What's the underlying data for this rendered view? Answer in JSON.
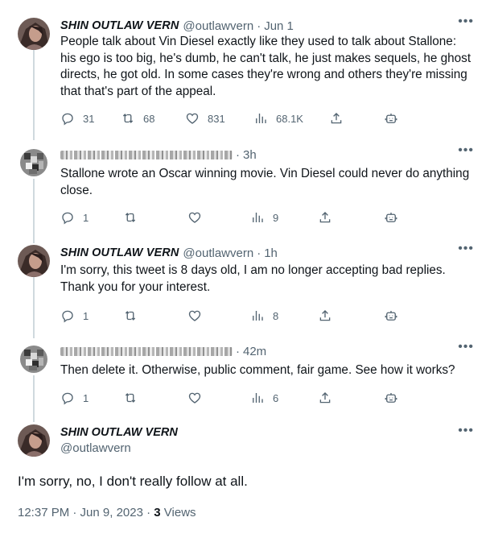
{
  "replies": [
    {
      "author_name": "SHIN OUTLAW VERN",
      "handle": "@outlawvern",
      "time": "Jun 1",
      "text": "People talk about Vin Diesel exactly like they used to talk about Stallone: his ego is too big, he's dumb, he can't talk, he just makes sequels, he ghost directs, he got old. In some cases they're wrong and others they're missing that that's part of the appeal.",
      "replies_count": "31",
      "retweets_count": "68",
      "likes_count": "831",
      "views_count": "68.1K"
    },
    {
      "author_name": "",
      "handle": "",
      "time": "3h",
      "text": "Stallone wrote an Oscar winning movie. Vin Diesel could never do anything close.",
      "replies_count": "1",
      "retweets_count": "",
      "likes_count": "",
      "views_count": "9"
    },
    {
      "author_name": "SHIN OUTLAW VERN",
      "handle": "@outlawvern",
      "time": "1h",
      "text": "I'm sorry, this tweet is 8 days old, I am no longer accepting bad replies. Thank you for your interest.",
      "replies_count": "1",
      "retweets_count": "",
      "likes_count": "",
      "views_count": "8"
    },
    {
      "author_name": "",
      "handle": "",
      "time": "42m",
      "text": "Then delete it. Otherwise, public comment, fair game. See how it works?",
      "replies_count": "1",
      "retweets_count": "",
      "likes_count": "",
      "views_count": "6"
    }
  ],
  "main_tweet": {
    "author_name": "SHIN OUTLAW VERN",
    "handle": "@outlawvern",
    "text": "I'm sorry, no, I don't really follow at all.",
    "timestamp": "12:37 PM · Jun 9, 2023",
    "views_number": "3",
    "views_label": "Views"
  },
  "ui": {
    "dot": "·",
    "more_glyph": "•••"
  },
  "icons": {
    "reply": "reply-icon",
    "retweet": "retweet-icon",
    "like": "heart-icon",
    "views": "views-chart-icon",
    "share": "share-icon",
    "grok": "robot-icon",
    "more": "more-icon"
  },
  "colors": {
    "text": "#0f1419",
    "secondary": "#536471",
    "thread_line": "#cfd9de"
  }
}
